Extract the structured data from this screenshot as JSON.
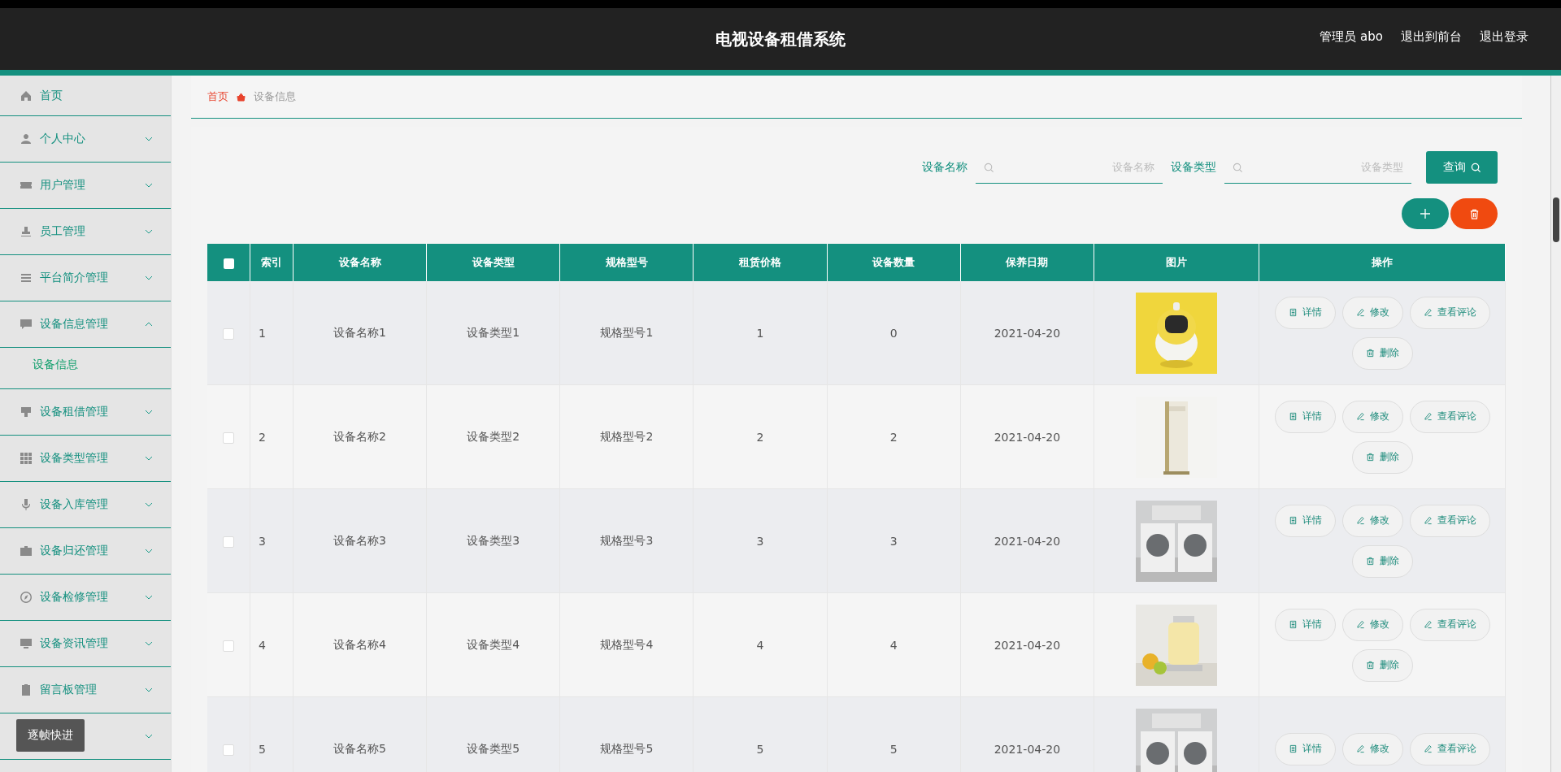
{
  "header": {
    "title": "电视设备租借系统",
    "links": [
      "管理员 abo",
      "退出到前台",
      "退出登录"
    ]
  },
  "sidebar": {
    "items": [
      {
        "kind": "link",
        "label": "首页"
      },
      {
        "kind": "menu",
        "label": "个人中心",
        "expanded": false
      },
      {
        "kind": "menu",
        "label": "用户管理",
        "expanded": false
      },
      {
        "kind": "menu",
        "label": "员工管理",
        "expanded": false
      },
      {
        "kind": "menu",
        "label": "平台简介管理",
        "expanded": false
      },
      {
        "kind": "menu",
        "label": "设备信息管理",
        "expanded": true,
        "children": [
          {
            "label": "设备信息",
            "selected": true
          }
        ]
      },
      {
        "kind": "menu",
        "label": "设备租借管理",
        "expanded": false
      },
      {
        "kind": "menu",
        "label": "设备类型管理",
        "expanded": false
      },
      {
        "kind": "menu",
        "label": "设备入库管理",
        "expanded": false
      },
      {
        "kind": "menu",
        "label": "设备归还管理",
        "expanded": false
      },
      {
        "kind": "menu",
        "label": "设备检修管理",
        "expanded": false
      },
      {
        "kind": "menu",
        "label": "设备资讯管理",
        "expanded": false
      },
      {
        "kind": "menu",
        "label": "留言板管理",
        "expanded": false
      },
      {
        "kind": "menu",
        "expanded": false
      }
    ]
  },
  "tooltip": "逐帧快进",
  "breadcrumb": [
    "首页",
    "设备信息"
  ],
  "search": {
    "fields": [
      {
        "label": "设备名称",
        "placeholder": "设备名称"
      },
      {
        "label": "设备类型",
        "placeholder": "设备类型"
      }
    ],
    "button": "查询"
  },
  "table": {
    "select_all_checked": false,
    "columns": [
      "索引",
      "设备名称",
      "设备类型",
      "规格型号",
      "租赁价格",
      "设备数量",
      "保养日期",
      "图片",
      "操作"
    ],
    "rows": [
      {
        "cells": [
          "1",
          "设备名称1",
          "设备类型1",
          "规格型号1",
          "1",
          "0",
          "2021-04-20"
        ],
        "checked": false,
        "actions": [
          "详情",
          "修改",
          "查看评论",
          "删除"
        ]
      },
      {
        "cells": [
          "2",
          "设备名称2",
          "设备类型2",
          "规格型号2",
          "2",
          "2",
          "2021-04-20"
        ],
        "checked": false,
        "actions": [
          "详情",
          "修改",
          "查看评论",
          "删除"
        ]
      },
      {
        "cells": [
          "3",
          "设备名称3",
          "设备类型3",
          "规格型号3",
          "3",
          "3",
          "2021-04-20"
        ],
        "checked": false,
        "actions": [
          "详情",
          "修改",
          "查看评论",
          "删除"
        ]
      },
      {
        "cells": [
          "4",
          "设备名称4",
          "设备类型4",
          "规格型号4",
          "4",
          "4",
          "2021-04-20"
        ],
        "checked": false,
        "actions": [
          "详情",
          "修改",
          "查看评论",
          "删除"
        ]
      },
      {
        "cells": [
          "5",
          "设备名称5",
          "设备类型5",
          "规格型号5",
          "5",
          "5",
          "2021-04-20"
        ],
        "checked": false,
        "actions": [
          "详情",
          "修改",
          "查看评论"
        ]
      }
    ]
  }
}
